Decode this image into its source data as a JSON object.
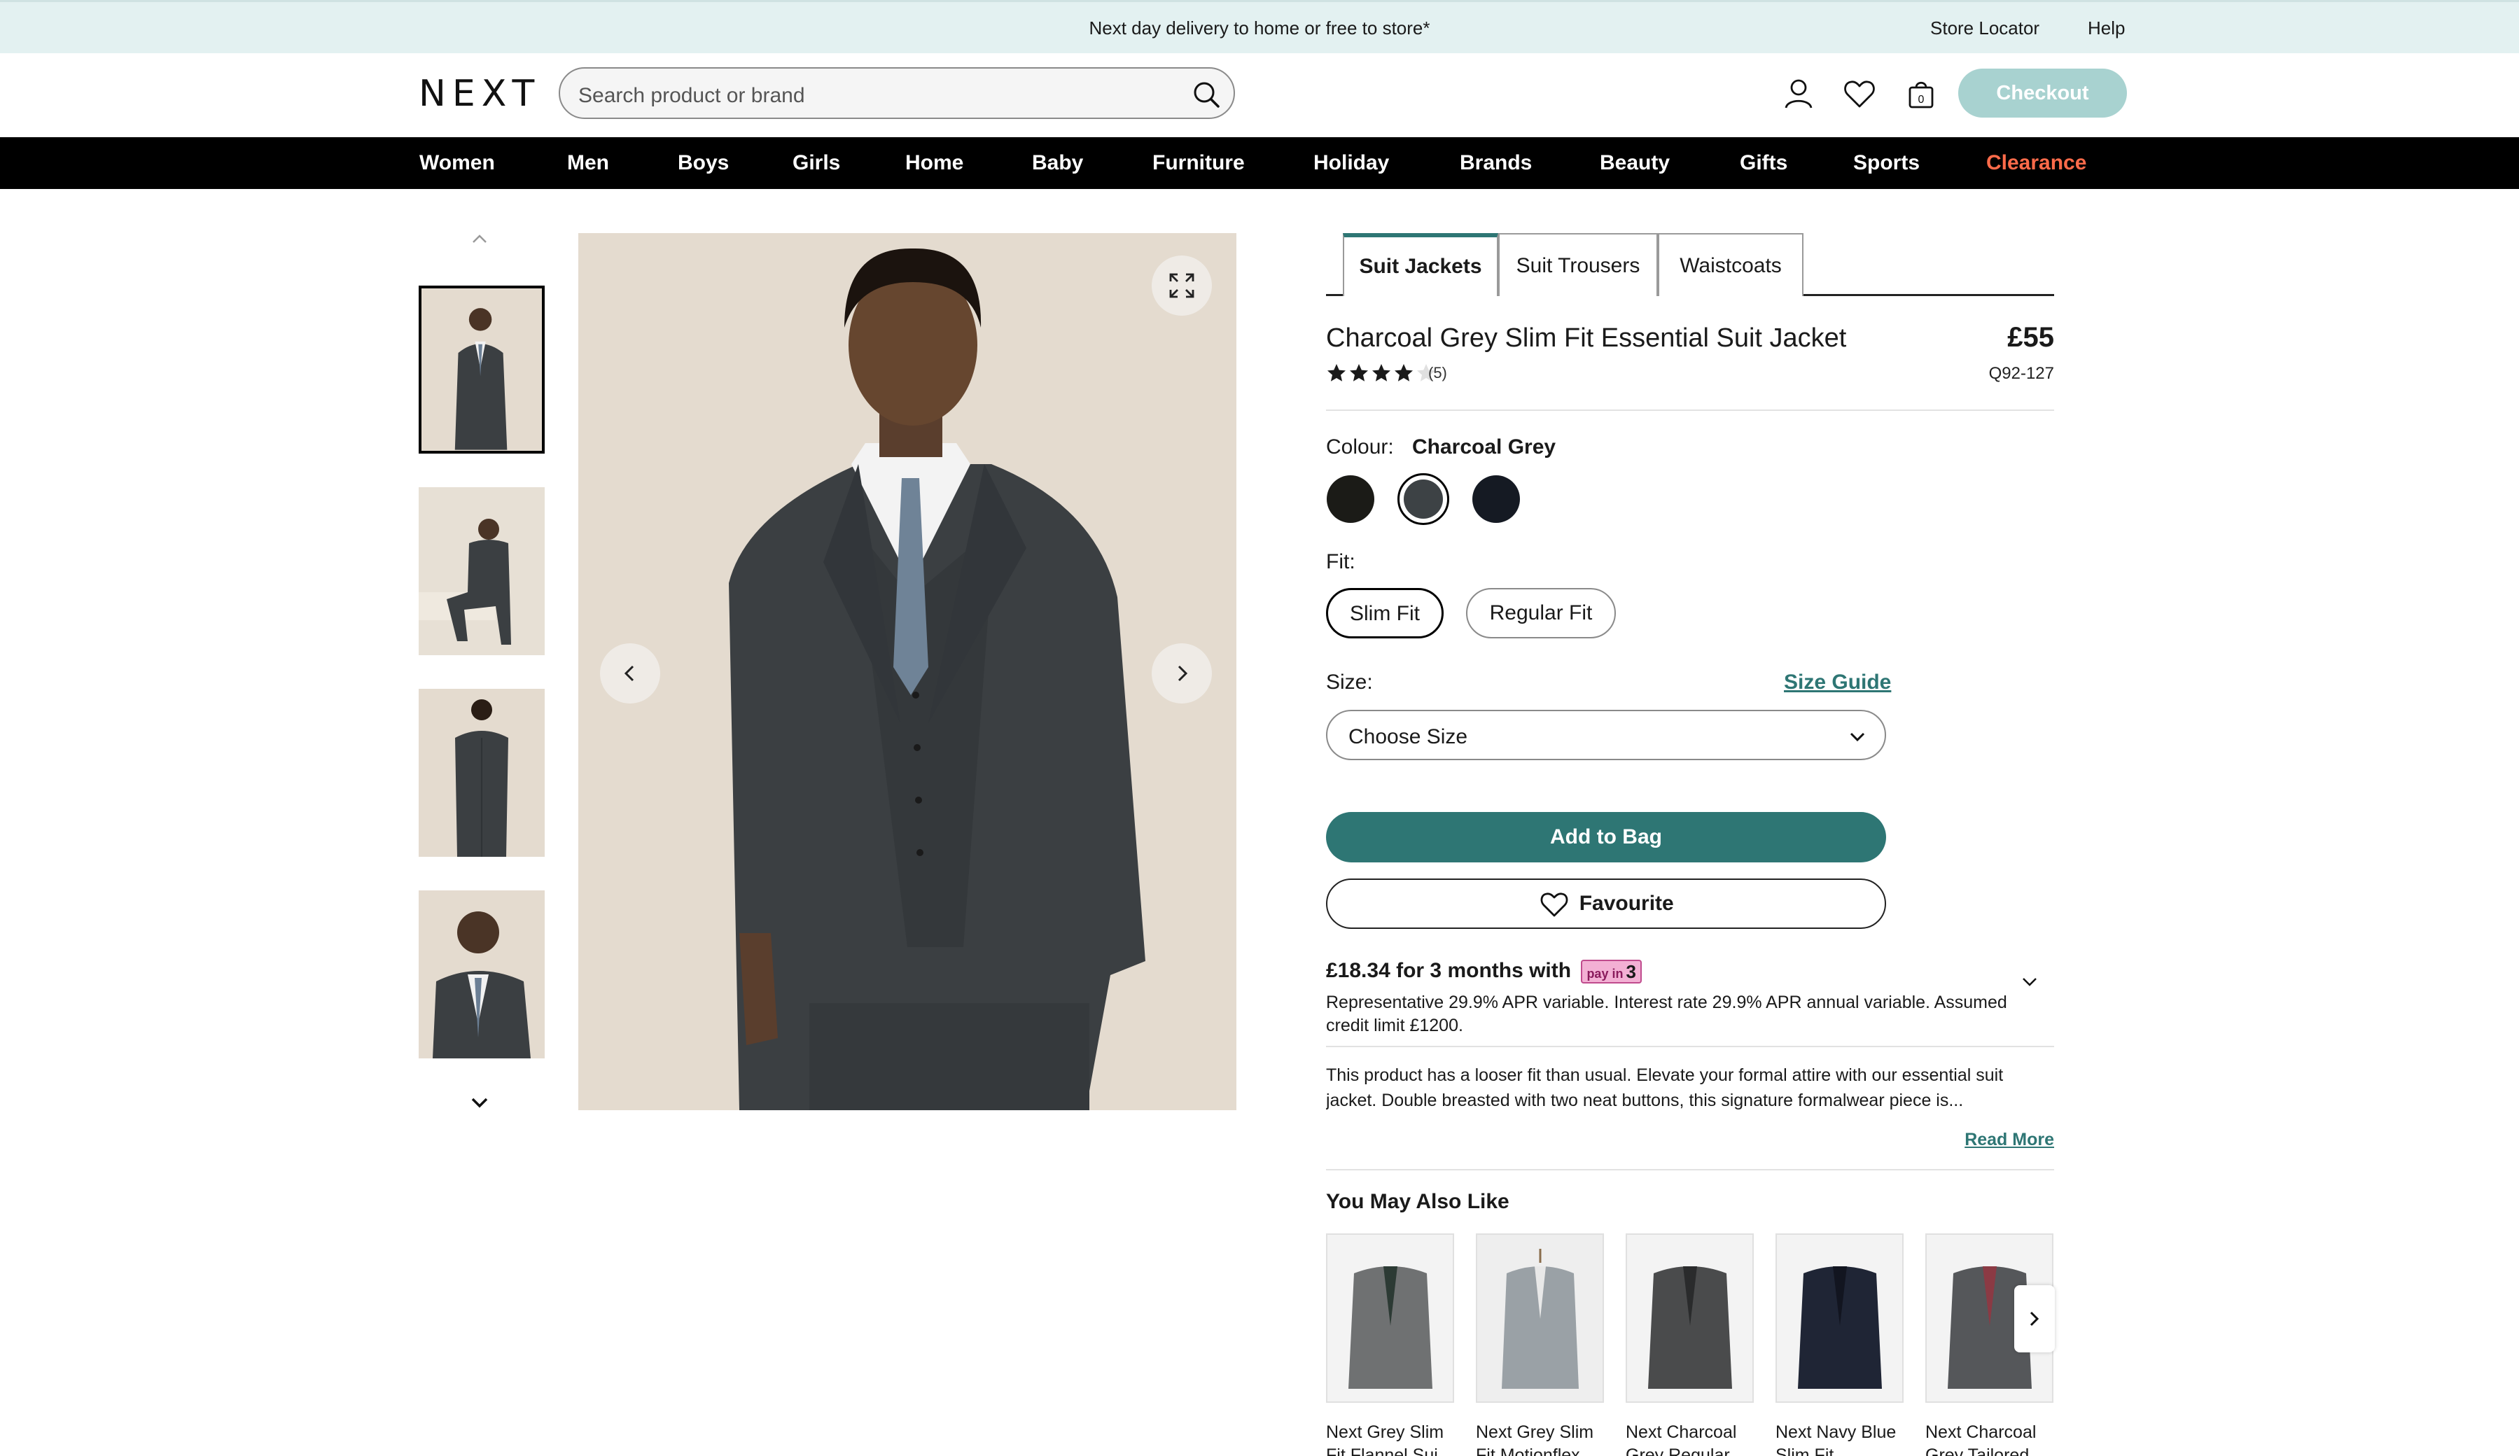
{
  "promo": {
    "message": "Next day delivery to home or free to store*",
    "store_locator": "Store Locator",
    "help": "Help"
  },
  "header": {
    "logo": "NEXT",
    "search_placeholder": "Search product or brand",
    "checkout": "Checkout",
    "bag_count": "0",
    "icons": [
      "account-icon",
      "heart-icon",
      "bag-icon",
      "search-icon"
    ]
  },
  "nav": {
    "items": [
      "Women",
      "Men",
      "Boys",
      "Girls",
      "Home",
      "Baby",
      "Furniture",
      "Holiday",
      "Brands",
      "Beauty",
      "Gifts",
      "Sports",
      "Clearance"
    ]
  },
  "product": {
    "tabs": [
      "Suit Jackets",
      "Suit Trousers",
      "Waistcoats"
    ],
    "active_tab": "Suit Jackets",
    "title": "Charcoal Grey Slim Fit Essential Suit Jacket",
    "price": "£55",
    "sku": "Q92-127",
    "rating": 4,
    "rating_max": 5,
    "reviews": "(5)",
    "colour_label": "Colour:",
    "colour_value": "Charcoal Grey",
    "swatches": [
      {
        "name": "Black",
        "color": "#1b1b17"
      },
      {
        "name": "Charcoal Grey",
        "color": "#3d4245"
      },
      {
        "name": "Navy",
        "color": "#151a23"
      }
    ],
    "fit_label": "Fit:",
    "fits": [
      "Slim Fit",
      "Regular Fit"
    ],
    "selected_fit": "Slim Fit",
    "size_label": "Size:",
    "size_guide": "Size Guide",
    "size_select": "Choose Size",
    "add_to_bag": "Add to Bag",
    "favourite": "Favourite",
    "payin": {
      "heading": "£18.34 for 3 months with",
      "badge": "pay in",
      "badge_num": "3",
      "text": "Representative 29.9% APR variable. Interest rate 29.9% APR annual variable. Assumed credit limit £1200."
    },
    "description": "This product has a looser fit than usual. Elevate your formal attire with our essential suit jacket. Double breasted with two neat buttons, this signature formalwear piece is...",
    "read_more": "Read More"
  },
  "recommendations": {
    "title": "You May Also Like",
    "items": [
      {
        "name": "Next Grey Slim Fit Flannel Sui...",
        "color": "#6f7172"
      },
      {
        "name": "Next Grey Slim Fit Motionflex...",
        "color": "#9aa1a6"
      },
      {
        "name": "Next Charcoal Grey Regular...",
        "color": "#4a4b4c"
      },
      {
        "name": "Next Navy Blue Slim Fit...",
        "color": "#1f2535"
      },
      {
        "name": "Next Charcoal Grey Tailored...",
        "color": "#55575a"
      }
    ]
  },
  "colors": {
    "accent": "#2e7674",
    "checkout_bg": "#a8d2d0",
    "promo_bg": "#e3f1f1",
    "clearance": "#ff6b4a"
  }
}
